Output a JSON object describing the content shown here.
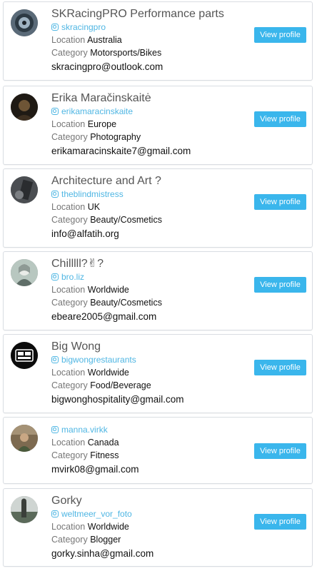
{
  "button_label": "View profile",
  "location_label": "Location",
  "category_label": "Category",
  "accent_color": "#3ab6ec",
  "handle_color": "#4fb6e3",
  "icon": "instagram-icon",
  "profiles": [
    {
      "name": "SKRacingPRO Performance parts",
      "handle": "skracingpro",
      "location": "Australia",
      "category": "Motorsports/Bikes",
      "email": "skracingpro@outlook.com"
    },
    {
      "name": "Erika Maračinskaitė",
      "handle": "erikamaracinskaite",
      "location": "Europe",
      "category": "Photography",
      "email": "erikamaracinskaite7@gmail.com"
    },
    {
      "name": "Architecture and Art ?",
      "handle": "theblindmistress",
      "location": "UK",
      "category": "Beauty/Cosmetics",
      "email": "info@alfatih.org"
    },
    {
      "name": "Chilllll?✌?",
      "handle": "bro.liz",
      "location": "Worldwide",
      "category": "Beauty/Cosmetics",
      "email": "ebeare2005@gmail.com"
    },
    {
      "name": "Big Wong",
      "handle": "bigwongrestaurants",
      "location": "Worldwide",
      "category": "Food/Beverage",
      "email": "bigwonghospitality@gmail.com"
    },
    {
      "name": "",
      "handle": "manna.virkk",
      "location": "Canada",
      "category": "Fitness",
      "email": "mvirk08@gmail.com"
    },
    {
      "name": "Gorky",
      "handle": "weltmeer_vor_foto",
      "location": "Worldwide",
      "category": "Blogger",
      "email": "gorky.sinha@gmail.com"
    }
  ]
}
